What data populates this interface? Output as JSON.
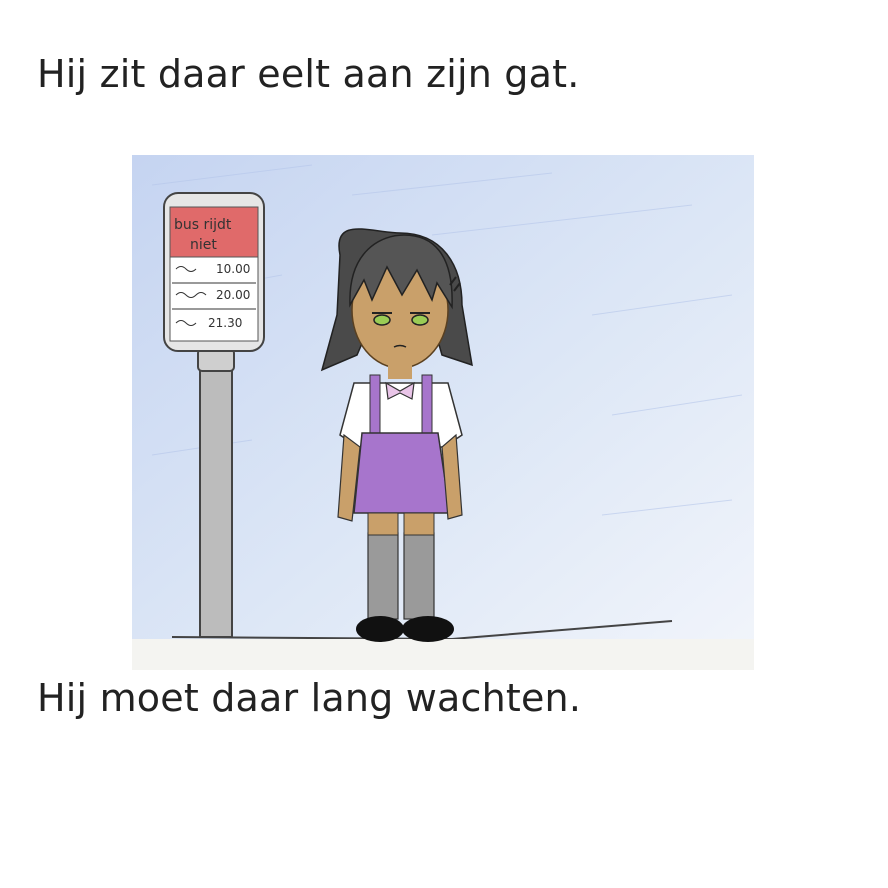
{
  "page": {
    "line1": "Hij zit daar eelt aan zijn gat.",
    "line2": "Hij moet daar lang wachten."
  },
  "illustration": {
    "sign_header": [
      "bus rijdt",
      "niet"
    ],
    "sign_times": [
      "10.00",
      "20.00",
      "21.30"
    ],
    "colors": {
      "sky": "#c9d8f0",
      "sign_header": "#e06a6a",
      "dress": "#a775cc",
      "hair": "#4a4a4a",
      "socks": "#9a9a9a",
      "skin": "#c9a06a"
    }
  }
}
